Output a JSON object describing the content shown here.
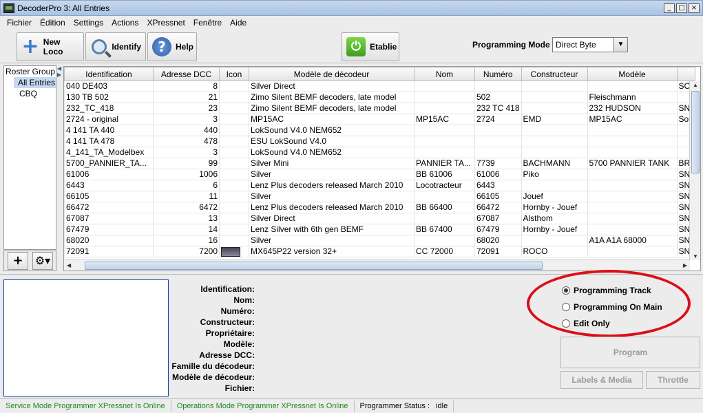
{
  "window": {
    "title": "DecoderPro 3: All Entries"
  },
  "menubar": [
    "Fichier",
    "Édition",
    "Settings",
    "Actions",
    "XPressnet",
    "Fenêtre",
    "Aide"
  ],
  "toolbar": {
    "new_loco": "New Loco",
    "identify": "Identify",
    "help": "Help",
    "power": "Etablie",
    "programming_mode_label": "Programming Mode",
    "programming_mode_value": "Direct Byte"
  },
  "roster_groups": {
    "header": "Roster Group",
    "items": [
      "All Entries",
      "CBQ"
    ]
  },
  "table": {
    "columns": [
      "Identification",
      "Adresse DCC",
      "Icon",
      "Modèle de décodeur",
      "Nom",
      "Numéro",
      "Constructeur",
      "Modèle",
      ""
    ],
    "rows": [
      [
        "040 DE403",
        "8",
        "",
        "Silver Direct",
        "",
        "",
        "",
        "",
        "SC"
      ],
      [
        "130 TB 502",
        "21",
        "",
        "Zimo Silent BEMF decoders, late model",
        "",
        "502",
        "",
        "Fleischmann",
        ""
      ],
      [
        "232_TC_418",
        "23",
        "",
        "Zimo Silent BEMF decoders, late model",
        "",
        "232 TC 418",
        "",
        "232 HUDSON",
        "SN"
      ],
      [
        "2724 - original",
        "3",
        "",
        "MP15AC",
        "MP15AC",
        "2724",
        "EMD",
        "MP15AC",
        "Sou"
      ],
      [
        "4 141 TA 440",
        "440",
        "",
        "LokSound V4.0 NEM652",
        "",
        "",
        "",
        "",
        ""
      ],
      [
        "4 141 TA 478",
        "478",
        "",
        "ESU LokSound V4.0",
        "",
        "",
        "",
        "",
        ""
      ],
      [
        "4_141_TA_Modelbex",
        "3",
        "",
        "LokSound V4.0 NEM652",
        "",
        "",
        "",
        "",
        ""
      ],
      [
        "5700_PANNIER_TA...",
        "99",
        "",
        "Silver Mini",
        "PANNIER TA...",
        "7739",
        "BACHMANN",
        "5700 PANNIER TANK",
        "BR"
      ],
      [
        "61006",
        "1006",
        "",
        "Silver",
        "BB 61006",
        "61006",
        "Piko",
        "",
        "SN"
      ],
      [
        "6443",
        "6",
        "",
        "Lenz Plus decoders released March 2010",
        "Locotracteur",
        "6443",
        "",
        "",
        "SN"
      ],
      [
        "66105",
        "11",
        "",
        "Silver",
        "",
        "66105",
        "Jouef",
        "",
        "SN"
      ],
      [
        "66472",
        "6472",
        "",
        "Lenz Plus decoders released March 2010",
        "BB 66400",
        "66472",
        "Hornby - Jouef",
        "",
        "SN"
      ],
      [
        "67087",
        "13",
        "",
        "Silver Direct",
        "",
        "67087",
        "Alsthom",
        "",
        "SN"
      ],
      [
        "67479",
        "14",
        "",
        "Lenz Silver with 6th gen BEMF",
        "BB 67400",
        "67479",
        "Hornby - Jouef",
        "",
        "SN"
      ],
      [
        "68020",
        "16",
        "",
        "Silver",
        "",
        "68020",
        "",
        "A1A A1A 68000",
        "SN"
      ],
      [
        "72091",
        "7200",
        "img",
        "MX645P22 version 32+",
        "CC 72000",
        "72091",
        "ROCO",
        "",
        "SN"
      ]
    ]
  },
  "details": {
    "labels": [
      "Identification:",
      "Nom:",
      "Numéro:",
      "Constructeur:",
      "Propriétaire:",
      "Modèle:",
      "Adresse DCC:",
      "Famille du décodeur:",
      "Modèle de décodeur:",
      "Fichier:"
    ]
  },
  "programming": {
    "options": [
      "Programming Track",
      "Programming On Main",
      "Edit Only"
    ],
    "selected": "Programming Track",
    "program_button": "Program",
    "labels_media_button": "Labels & Media",
    "throttle_button": "Throttle"
  },
  "status": {
    "service": "Service Mode Programmer XPressnet Is Online",
    "operations": "Operations Mode Programmer XPressnet Is Online",
    "programmer_label": "Programmer Status :",
    "programmer_value": "idle"
  },
  "colors": {
    "highlight_ellipse": "#d9101a",
    "online_text": "#1c8a1c"
  }
}
